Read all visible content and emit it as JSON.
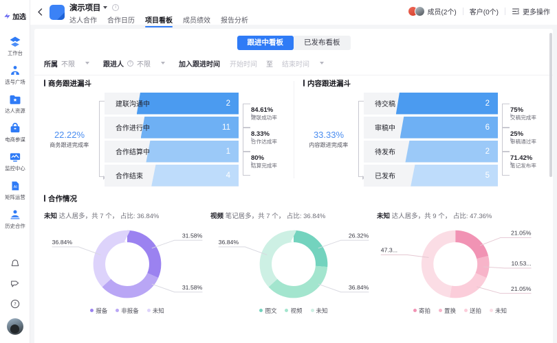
{
  "brand": {
    "name": "加选",
    "logo_icon": "jiaxuan-logo-icon"
  },
  "sidebar": {
    "items": [
      {
        "label": "工作台",
        "icon": "workbench-icon"
      },
      {
        "label": "选号广场",
        "icon": "account-plaza-icon"
      },
      {
        "label": "达人资源",
        "icon": "influencer-resource-icon"
      },
      {
        "label": "电商参谋",
        "icon": "ecommerce-advisor-icon"
      },
      {
        "label": "监控中心",
        "icon": "monitor-center-icon"
      },
      {
        "label": "矩阵运营",
        "icon": "matrix-operation-icon"
      },
      {
        "label": "历史合作",
        "icon": "history-cooperation-icon"
      }
    ],
    "bottom": [
      {
        "icon": "bell-icon"
      },
      {
        "icon": "feedback-icon"
      },
      {
        "icon": "help-question-icon"
      },
      {
        "icon": "user-avatar"
      }
    ]
  },
  "header": {
    "back_icon": "back-chevron-icon",
    "project_icon": "project-folder-icon",
    "project_name": "演示项目",
    "dropdown_icon": "chevron-down-icon",
    "info_icon": "info-circle-icon",
    "tabs": [
      {
        "label": "达人合作",
        "active": false
      },
      {
        "label": "合作日历",
        "active": false
      },
      {
        "label": "项目看板",
        "active": true
      },
      {
        "label": "成员绩效",
        "active": false
      },
      {
        "label": "报告分析",
        "active": false
      }
    ],
    "members_label": "成员(2个)",
    "clients_label": "客户(0个)",
    "more_actions_label": "更多操作",
    "more_actions_icon": "more-actions-icon"
  },
  "board_toggle": {
    "options": [
      {
        "label": "跟进中看板",
        "active": true
      },
      {
        "label": "已发布看板",
        "active": false
      }
    ],
    "highlight_color": "#d23c26",
    "active_color": "#2f7bf6"
  },
  "filters": {
    "ownership": {
      "label": "所属",
      "value": "不限"
    },
    "follower": {
      "label": "跟进人",
      "value": "不限",
      "help_icon": "question-circle-icon"
    },
    "join_time": {
      "label": "加入跟进时间",
      "start_placeholder": "开始时间",
      "separator": "至",
      "end_placeholder": "结束时间"
    }
  },
  "chart_data": [
    {
      "type": "bar",
      "title": "商务跟进漏斗",
      "categories": [
        "建联沟通中",
        "合作进行中",
        "合作结算中",
        "合作结束"
      ],
      "values": [
        2,
        11,
        1,
        4
      ],
      "overall": {
        "pct": "22.22%",
        "label": "商务跟进完成率"
      },
      "conversions": [
        {
          "pct": "84.61%",
          "label": "建联成功率"
        },
        {
          "pct": "8.33%",
          "label": "合作达成率"
        },
        {
          "pct": "80%",
          "label": "结算完成率"
        }
      ],
      "colors": [
        "#4b9bf0",
        "#6eb0f4",
        "#9bc9f8",
        "#bedcfb"
      ]
    },
    {
      "type": "bar",
      "title": "内容跟进漏斗",
      "categories": [
        "待交稿",
        "审稿中",
        "待发布",
        "已发布"
      ],
      "values": [
        2,
        6,
        2,
        5
      ],
      "overall": {
        "pct": "33.33%",
        "label": "内容跟进完成率"
      },
      "conversions": [
        {
          "pct": "75%",
          "label": "交稿完成率"
        },
        {
          "pct": "25%",
          "label": "审稿通过率"
        },
        {
          "pct": "71.42%",
          "label": "笔记发布率"
        }
      ],
      "colors": [
        "#4b9bf0",
        "#6eb0f4",
        "#9bc9f8",
        "#bedcfb"
      ]
    },
    {
      "type": "pie",
      "subtitle_prefix": "未知",
      "subtitle_rest": " 达人居多，共 7 个， 占比: 36.84%",
      "categories": [
        "报备",
        "非报备",
        "未知"
      ],
      "values": [
        31.58,
        31.58,
        36.84
      ],
      "labels": [
        "31.58%",
        "31.58%",
        "36.84%"
      ],
      "colors": [
        "#9b82f0",
        "#b9a6f5",
        "#ddd3fb"
      ]
    },
    {
      "type": "pie",
      "subtitle_prefix": "视频",
      "subtitle_rest": " 笔记居多，共 7 个， 占比: 36.84%",
      "categories": [
        "图文",
        "视频",
        "未知"
      ],
      "values": [
        26.32,
        36.84,
        36.84
      ],
      "labels": [
        "26.32%",
        "36.84%",
        "36.84%"
      ],
      "colors": [
        "#73d3be",
        "#a3e5ce",
        "#cdf0e4"
      ]
    },
    {
      "type": "pie",
      "subtitle_prefix": "未知",
      "subtitle_rest": " 达人居多，共 9 个， 占比: 47.36%",
      "categories": [
        "寄拍",
        "置换",
        "送拍",
        "未知"
      ],
      "values": [
        21.05,
        10.53,
        21.05,
        47.37
      ],
      "labels": [
        "21.05%",
        "10.53...",
        "21.05%",
        "47.3..."
      ],
      "colors": [
        "#f193b4",
        "#f7b4c9",
        "#fbcdda",
        "#fbdde5"
      ]
    }
  ],
  "coop_section": {
    "title": "合作情况",
    "section_mark": "section-bar"
  }
}
